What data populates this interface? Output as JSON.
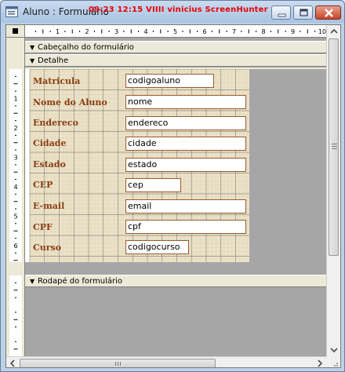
{
  "window": {
    "title": "Aluno : Formulário",
    "overlay_text": "09:23  12:15  VIIII  vinicius  ScreenHunter",
    "controls": {
      "minimize": "minimize",
      "maximize": "maximize",
      "close": "close"
    }
  },
  "ruler": {
    "h_numbers": [
      "1",
      "2",
      "3",
      "4",
      "5",
      "6",
      "7",
      "8",
      "9",
      "10"
    ],
    "v_numbers": [
      "1",
      "2",
      "3",
      "4",
      "5",
      "6",
      "1"
    ]
  },
  "sections": {
    "header": "Cabeçalho do formulário",
    "detail": "Detalhe",
    "footer": "Rodapé do formulário"
  },
  "fields": [
    {
      "label": "Matricula",
      "value": "codigoaluno"
    },
    {
      "label": "Nome do Aluno",
      "value": "nome"
    },
    {
      "label": "Endereco",
      "value": "endereco"
    },
    {
      "label": "Cidade",
      "value": "cidade"
    },
    {
      "label": "Estado",
      "value": "estado"
    },
    {
      "label": "CEP",
      "value": "cep"
    },
    {
      "label": "E-mail",
      "value": "email"
    },
    {
      "label": "CPF",
      "value": "cpf"
    },
    {
      "label": "Curso",
      "value": "codigocurso"
    }
  ],
  "colors": {
    "label_text": "#8b3d12",
    "field_border": "#9b5a2e",
    "overlay_text": "#e60000",
    "background_gray": "#a6a6a6"
  }
}
